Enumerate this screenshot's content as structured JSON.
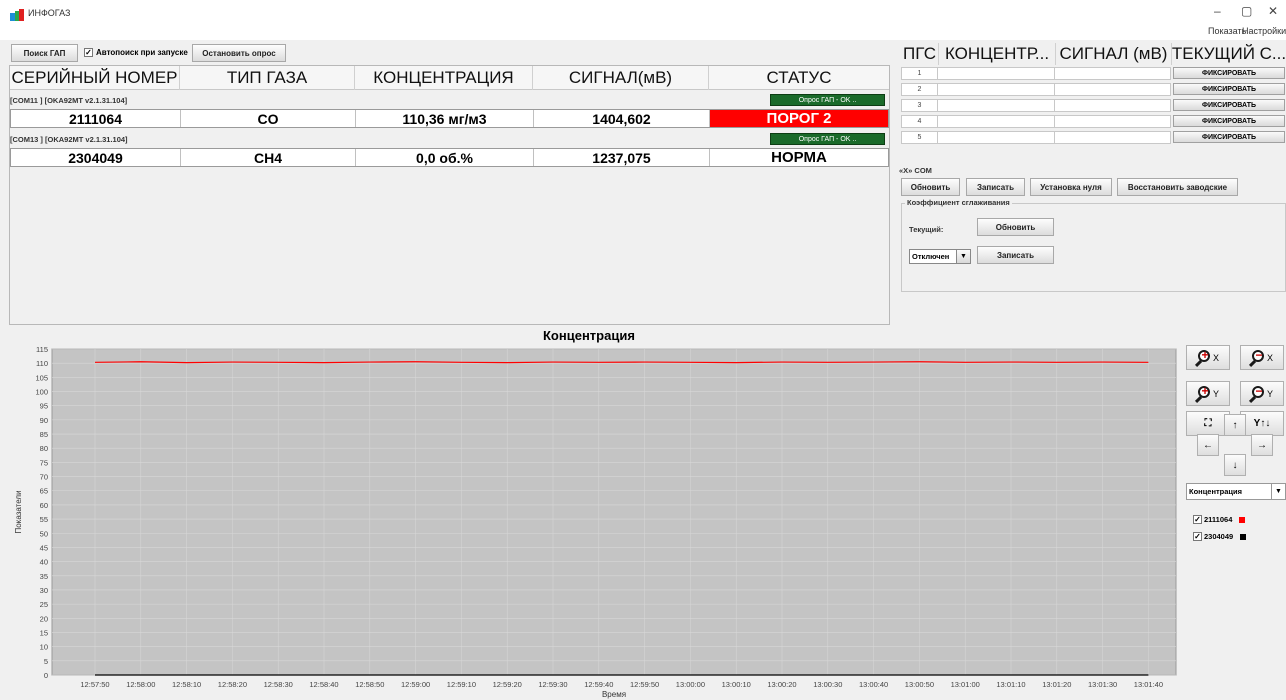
{
  "window": {
    "title": "ИНФОГАЗ",
    "minimize": "–",
    "maximize": "▢",
    "close": "✕"
  },
  "menu": {
    "show": "Показать",
    "settings": "Настройки"
  },
  "toolbar": {
    "search_label": "Поиск ГАП",
    "autosearch_label": "Автопоиск при запуске",
    "autosearch_checked": true,
    "stop_label": "Остановить опрос"
  },
  "table": {
    "headers": [
      "СЕРИЙНЫЙ НОМЕР",
      "ТИП ГАЗА",
      "КОНЦЕНТРАЦИЯ",
      "СИГНАЛ(мВ)",
      "СТАТУС"
    ],
    "devices": [
      {
        "port_label": "[COM11 ] [OKA92MT v2.1.31.104]",
        "poll_status": "Опрос ГАП - OK ..",
        "serial": "2111064",
        "gas": "CO",
        "concentration": "110,36 мг/м3",
        "signal": "1404,602",
        "status": "ПОРОГ 2",
        "status_color": "#ff0000"
      },
      {
        "port_label": "[COM13 ] [OKA92MT v2.1.31.104]",
        "poll_status": "Опрос ГАП - OK ..",
        "serial": "2304049",
        "gas": "CH4",
        "concentration": "0,0 об.%",
        "signal": "1237,075",
        "status": "НОРМА",
        "status_color": "#ffffff"
      }
    ]
  },
  "pgs": {
    "headers": [
      "ПГС",
      "КОНЦЕНТР...",
      "СИГНАЛ (мВ)",
      "ТЕКУЩИЙ С..."
    ],
    "rows": [
      "1",
      "2",
      "3",
      "4",
      "5"
    ],
    "fix_label": "ФИКСИРОВАТЬ"
  },
  "com_panel": {
    "title": "«X» COM",
    "refresh_label": "Обновить",
    "write_label": "Записать",
    "zero_label": "Установка нуля",
    "restore_label": "Восстановить заводские",
    "smoothing": {
      "legend": "Коэффициент сглаживания",
      "current_label": "Текущий:",
      "refresh_label": "Обновить",
      "select_value": "Отключен",
      "write_label": "Записать"
    }
  },
  "chart_controls": {
    "zoom_in_x": "X",
    "zoom_out_x": "X",
    "zoom_in_y": "Y",
    "zoom_out_y": "Y",
    "fit_icon": "⛶",
    "y_sort_label": "Y↑↓",
    "up": "↑",
    "left": "←",
    "right": "→",
    "down": "↓",
    "series_select": "Концентрация",
    "legend": [
      {
        "name": "2111064",
        "checked": true,
        "color": "#ff0000"
      },
      {
        "name": "2304049",
        "checked": true,
        "color": "#000000"
      }
    ]
  },
  "chart_data": {
    "type": "line",
    "title": "Концентрация",
    "xlabel": "Время",
    "ylabel": "Показатели",
    "ylim": [
      0,
      115
    ],
    "yticks": [
      0,
      5,
      10,
      15,
      20,
      25,
      30,
      35,
      40,
      45,
      50,
      55,
      60,
      65,
      70,
      75,
      80,
      85,
      90,
      95,
      100,
      105,
      110,
      115
    ],
    "x": [
      "12:57:50",
      "12:58:00",
      "12:58:10",
      "12:58:20",
      "12:58:30",
      "12:58:40",
      "12:58:50",
      "12:59:00",
      "12:59:10",
      "12:59:20",
      "12:59:30",
      "12:59:40",
      "12:59:50",
      "13:00:00",
      "13:00:10",
      "13:00:20",
      "13:00:30",
      "13:00:40",
      "13:00:50",
      "13:01:00",
      "13:01:10",
      "13:01:20",
      "13:01:30",
      "13:01:40"
    ],
    "series": [
      {
        "name": "2111064",
        "color": "#ff0000",
        "values": [
          110.3,
          110.5,
          110.2,
          110.4,
          110.3,
          110.2,
          110.4,
          110.5,
          110.3,
          110.2,
          110.4,
          110.3,
          110.4,
          110.3,
          110.2,
          110.4,
          110.3,
          110.4,
          110.5,
          110.3,
          110.4,
          110.3,
          110.4,
          110.3
        ]
      },
      {
        "name": "2304049",
        "color": "#000000",
        "values": [
          0.0,
          0.0,
          0.0,
          0.0,
          0.0,
          0.0,
          0.0,
          0.0,
          0.0,
          0.0,
          0.0,
          0.0,
          0.0,
          0.0,
          0.0,
          0.0,
          0.0,
          0.0,
          0.0,
          0.0,
          0.0,
          0.0,
          0.0,
          0.0
        ]
      }
    ],
    "grid": true
  }
}
